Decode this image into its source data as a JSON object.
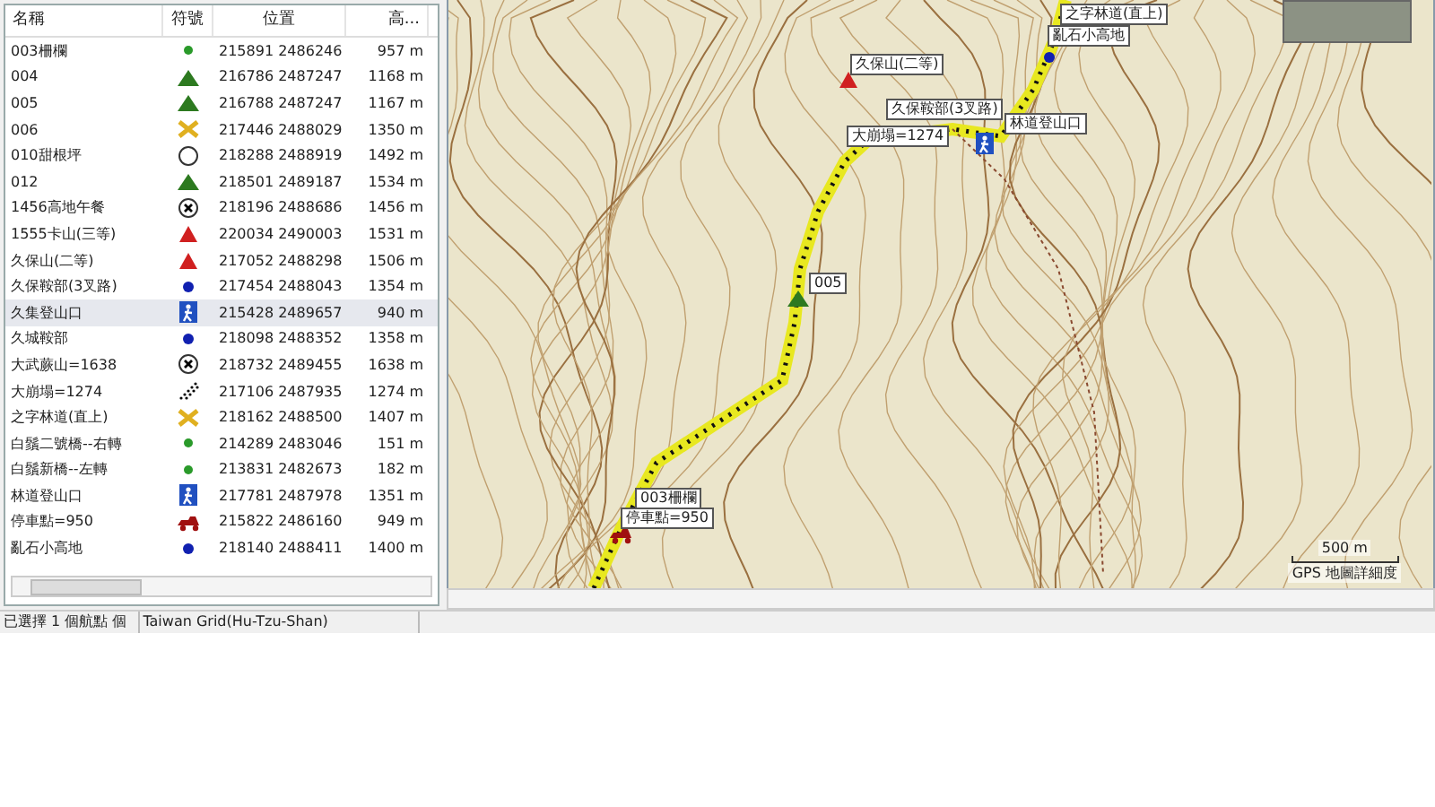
{
  "waypoint_table": {
    "columns": [
      "名稱",
      "符號",
      "位置",
      "高..."
    ],
    "rows": [
      {
        "name": "003柵欄",
        "kind": "dot-green",
        "position": "215891 2486246",
        "elevation": "957 m",
        "selected": false
      },
      {
        "name": "004",
        "kind": "tent",
        "position": "216786 2487247",
        "elevation": "1168 m",
        "selected": false
      },
      {
        "name": "005",
        "kind": "tent",
        "position": "216788 2487247",
        "elevation": "1167 m",
        "selected": false
      },
      {
        "name": "006",
        "kind": "cross",
        "position": "217446 2488029",
        "elevation": "1350 m",
        "selected": false
      },
      {
        "name": "010甜根坪",
        "kind": "circle",
        "position": "218288 2488919",
        "elevation": "1492 m",
        "selected": false
      },
      {
        "name": "012",
        "kind": "tent",
        "position": "218501 2489187",
        "elevation": "1534 m",
        "selected": false
      },
      {
        "name": "1456高地午餐",
        "kind": "x-circle",
        "position": "218196 2488686",
        "elevation": "1456 m",
        "selected": false
      },
      {
        "name": "1555卡山(三等)",
        "kind": "triangle",
        "position": "220034 2490003",
        "elevation": "1531 m",
        "selected": false
      },
      {
        "name": "久保山(二等)",
        "kind": "triangle",
        "position": "217052 2488298",
        "elevation": "1506 m",
        "selected": false
      },
      {
        "name": "久保鞍部(3叉路)",
        "kind": "dot-blue",
        "position": "217454 2488043",
        "elevation": "1354 m",
        "selected": false
      },
      {
        "name": "久集登山口",
        "kind": "hiker",
        "position": "215428 2489657",
        "elevation": "940 m",
        "selected": true
      },
      {
        "name": "久城鞍部",
        "kind": "dot-blue",
        "position": "218098 2488352",
        "elevation": "1358 m",
        "selected": false
      },
      {
        "name": "大武蕨山=1638",
        "kind": "x-circle",
        "position": "218732 2489455",
        "elevation": "1638 m",
        "selected": false
      },
      {
        "name": "大崩塌=1274",
        "kind": "dots",
        "position": "217106 2487935",
        "elevation": "1274 m",
        "selected": false
      },
      {
        "name": "之字林道(直上)",
        "kind": "cross",
        "position": "218162 2488500",
        "elevation": "1407 m",
        "selected": false
      },
      {
        "name": "白鬚二號橋--右轉",
        "kind": "dot-green",
        "position": "214289 2483046",
        "elevation": "151 m",
        "selected": false
      },
      {
        "name": "白鬚新橋--左轉",
        "kind": "dot-green",
        "position": "213831 2482673",
        "elevation": "182 m",
        "selected": false
      },
      {
        "name": "林道登山口",
        "kind": "hiker",
        "position": "217781 2487978",
        "elevation": "1351 m",
        "selected": false
      },
      {
        "name": "停車點=950",
        "kind": "car",
        "position": "215822 2486160",
        "elevation": "949 m",
        "selected": false
      },
      {
        "name": "亂石小高地",
        "kind": "dot-blue",
        "position": "218140 2488411",
        "elevation": "1400 m",
        "selected": false
      }
    ]
  },
  "map": {
    "labels": [
      "之字林道(直上)",
      "亂石小高地",
      "久保山(二等)",
      "久保鞍部(3叉路)",
      "林道登山口",
      "大崩塌=1274",
      "005",
      "003柵欄",
      "停車點=950"
    ],
    "scale": "500 m",
    "detail": "GPS 地圖詳細度"
  },
  "status_bar": [
    "已選擇 1 個航點 個",
    "Taiwan Grid(Hu-Tzu-Shan)"
  ]
}
